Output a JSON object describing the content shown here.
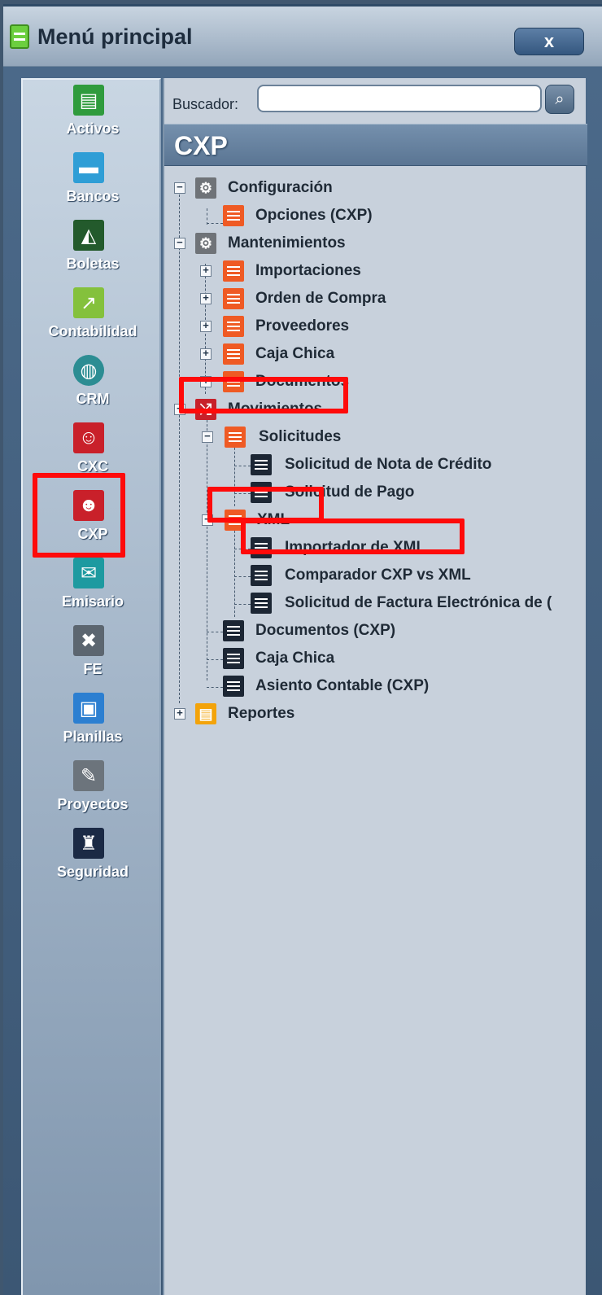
{
  "window": {
    "title": "Menú principal",
    "close_label": "x"
  },
  "modules": [
    {
      "label": "Activos",
      "icon": "cash-register-icon",
      "color": "#2f9b3d"
    },
    {
      "label": "Bancos",
      "icon": "briefcase-icon",
      "color": "#2f9ed6"
    },
    {
      "label": "Boletas",
      "icon": "presentation-icon",
      "color": "#235a2c"
    },
    {
      "label": "Contabilidad",
      "icon": "chart-icon",
      "color": "#84c13c"
    },
    {
      "label": "CRM",
      "icon": "globe-icon",
      "color": "#2c8d93"
    },
    {
      "label": "CXC",
      "icon": "person-money-icon",
      "color": "#c9202a"
    },
    {
      "label": "CXP",
      "icon": "person-coins-icon",
      "color": "#c9202a"
    },
    {
      "label": "Emisario",
      "icon": "envelope-icon",
      "color": "#1d9aa0"
    },
    {
      "label": "FE",
      "icon": "tools-icon",
      "color": "#5c6670"
    },
    {
      "label": "Planillas",
      "icon": "document-icon",
      "color": "#2c7fd1"
    },
    {
      "label": "Proyectos",
      "icon": "pencil-ruler-icon",
      "color": "#6c747c"
    },
    {
      "label": "Seguridad",
      "icon": "castle-icon",
      "color": "#1b2a45"
    }
  ],
  "search": {
    "label": "Buscador:",
    "value": "",
    "placeholder": ""
  },
  "section": {
    "title": "CXP"
  },
  "tree": {
    "configuracion": "Configuración",
    "opciones": "Opciones (CXP)",
    "mantenimientos": "Mantenimientos",
    "importaciones": "Importaciones",
    "orden_compra": "Orden de Compra",
    "proveedores": "Proveedores",
    "caja_chica_m": "Caja Chica",
    "documentos_m": "Documentos",
    "movimientos": "Movimientos",
    "solicitudes": "Solicitudes",
    "sol_nota_credito": "Solicitud de Nota de Crédito",
    "sol_pago": "Solicitud de Pago",
    "xml": "XML",
    "importador_xml": "Importador de XML",
    "comparador": "Comparador CXP vs XML",
    "sol_factura": "Solicitud de Factura Electrónica de (",
    "documentos_cxp": "Documentos (CXP)",
    "caja_chica": "Caja Chica",
    "asiento": "Asiento Contable (CXP)",
    "reportes": "Reportes"
  },
  "colors": {
    "highlight": "#ff0a0a",
    "orange_list": "#ef5a24",
    "dark_list": "#1c2634"
  }
}
